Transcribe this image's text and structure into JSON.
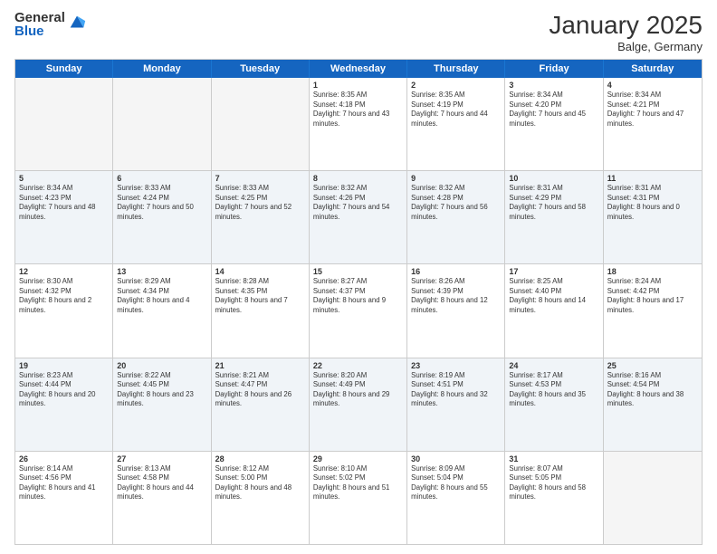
{
  "logo": {
    "general": "General",
    "blue": "Blue"
  },
  "title": "January 2025",
  "location": "Balge, Germany",
  "header_days": [
    "Sunday",
    "Monday",
    "Tuesday",
    "Wednesday",
    "Thursday",
    "Friday",
    "Saturday"
  ],
  "weeks": [
    [
      {
        "day": "",
        "sunrise": "",
        "sunset": "",
        "daylight": "",
        "empty": true
      },
      {
        "day": "",
        "sunrise": "",
        "sunset": "",
        "daylight": "",
        "empty": true
      },
      {
        "day": "",
        "sunrise": "",
        "sunset": "",
        "daylight": "",
        "empty": true
      },
      {
        "day": "1",
        "sunrise": "Sunrise: 8:35 AM",
        "sunset": "Sunset: 4:18 PM",
        "daylight": "Daylight: 7 hours and 43 minutes.",
        "empty": false
      },
      {
        "day": "2",
        "sunrise": "Sunrise: 8:35 AM",
        "sunset": "Sunset: 4:19 PM",
        "daylight": "Daylight: 7 hours and 44 minutes.",
        "empty": false
      },
      {
        "day": "3",
        "sunrise": "Sunrise: 8:34 AM",
        "sunset": "Sunset: 4:20 PM",
        "daylight": "Daylight: 7 hours and 45 minutes.",
        "empty": false
      },
      {
        "day": "4",
        "sunrise": "Sunrise: 8:34 AM",
        "sunset": "Sunset: 4:21 PM",
        "daylight": "Daylight: 7 hours and 47 minutes.",
        "empty": false
      }
    ],
    [
      {
        "day": "5",
        "sunrise": "Sunrise: 8:34 AM",
        "sunset": "Sunset: 4:23 PM",
        "daylight": "Daylight: 7 hours and 48 minutes.",
        "empty": false
      },
      {
        "day": "6",
        "sunrise": "Sunrise: 8:33 AM",
        "sunset": "Sunset: 4:24 PM",
        "daylight": "Daylight: 7 hours and 50 minutes.",
        "empty": false
      },
      {
        "day": "7",
        "sunrise": "Sunrise: 8:33 AM",
        "sunset": "Sunset: 4:25 PM",
        "daylight": "Daylight: 7 hours and 52 minutes.",
        "empty": false
      },
      {
        "day": "8",
        "sunrise": "Sunrise: 8:32 AM",
        "sunset": "Sunset: 4:26 PM",
        "daylight": "Daylight: 7 hours and 54 minutes.",
        "empty": false
      },
      {
        "day": "9",
        "sunrise": "Sunrise: 8:32 AM",
        "sunset": "Sunset: 4:28 PM",
        "daylight": "Daylight: 7 hours and 56 minutes.",
        "empty": false
      },
      {
        "day": "10",
        "sunrise": "Sunrise: 8:31 AM",
        "sunset": "Sunset: 4:29 PM",
        "daylight": "Daylight: 7 hours and 58 minutes.",
        "empty": false
      },
      {
        "day": "11",
        "sunrise": "Sunrise: 8:31 AM",
        "sunset": "Sunset: 4:31 PM",
        "daylight": "Daylight: 8 hours and 0 minutes.",
        "empty": false
      }
    ],
    [
      {
        "day": "12",
        "sunrise": "Sunrise: 8:30 AM",
        "sunset": "Sunset: 4:32 PM",
        "daylight": "Daylight: 8 hours and 2 minutes.",
        "empty": false
      },
      {
        "day": "13",
        "sunrise": "Sunrise: 8:29 AM",
        "sunset": "Sunset: 4:34 PM",
        "daylight": "Daylight: 8 hours and 4 minutes.",
        "empty": false
      },
      {
        "day": "14",
        "sunrise": "Sunrise: 8:28 AM",
        "sunset": "Sunset: 4:35 PM",
        "daylight": "Daylight: 8 hours and 7 minutes.",
        "empty": false
      },
      {
        "day": "15",
        "sunrise": "Sunrise: 8:27 AM",
        "sunset": "Sunset: 4:37 PM",
        "daylight": "Daylight: 8 hours and 9 minutes.",
        "empty": false
      },
      {
        "day": "16",
        "sunrise": "Sunrise: 8:26 AM",
        "sunset": "Sunset: 4:39 PM",
        "daylight": "Daylight: 8 hours and 12 minutes.",
        "empty": false
      },
      {
        "day": "17",
        "sunrise": "Sunrise: 8:25 AM",
        "sunset": "Sunset: 4:40 PM",
        "daylight": "Daylight: 8 hours and 14 minutes.",
        "empty": false
      },
      {
        "day": "18",
        "sunrise": "Sunrise: 8:24 AM",
        "sunset": "Sunset: 4:42 PM",
        "daylight": "Daylight: 8 hours and 17 minutes.",
        "empty": false
      }
    ],
    [
      {
        "day": "19",
        "sunrise": "Sunrise: 8:23 AM",
        "sunset": "Sunset: 4:44 PM",
        "daylight": "Daylight: 8 hours and 20 minutes.",
        "empty": false
      },
      {
        "day": "20",
        "sunrise": "Sunrise: 8:22 AM",
        "sunset": "Sunset: 4:45 PM",
        "daylight": "Daylight: 8 hours and 23 minutes.",
        "empty": false
      },
      {
        "day": "21",
        "sunrise": "Sunrise: 8:21 AM",
        "sunset": "Sunset: 4:47 PM",
        "daylight": "Daylight: 8 hours and 26 minutes.",
        "empty": false
      },
      {
        "day": "22",
        "sunrise": "Sunrise: 8:20 AM",
        "sunset": "Sunset: 4:49 PM",
        "daylight": "Daylight: 8 hours and 29 minutes.",
        "empty": false
      },
      {
        "day": "23",
        "sunrise": "Sunrise: 8:19 AM",
        "sunset": "Sunset: 4:51 PM",
        "daylight": "Daylight: 8 hours and 32 minutes.",
        "empty": false
      },
      {
        "day": "24",
        "sunrise": "Sunrise: 8:17 AM",
        "sunset": "Sunset: 4:53 PM",
        "daylight": "Daylight: 8 hours and 35 minutes.",
        "empty": false
      },
      {
        "day": "25",
        "sunrise": "Sunrise: 8:16 AM",
        "sunset": "Sunset: 4:54 PM",
        "daylight": "Daylight: 8 hours and 38 minutes.",
        "empty": false
      }
    ],
    [
      {
        "day": "26",
        "sunrise": "Sunrise: 8:14 AM",
        "sunset": "Sunset: 4:56 PM",
        "daylight": "Daylight: 8 hours and 41 minutes.",
        "empty": false
      },
      {
        "day": "27",
        "sunrise": "Sunrise: 8:13 AM",
        "sunset": "Sunset: 4:58 PM",
        "daylight": "Daylight: 8 hours and 44 minutes.",
        "empty": false
      },
      {
        "day": "28",
        "sunrise": "Sunrise: 8:12 AM",
        "sunset": "Sunset: 5:00 PM",
        "daylight": "Daylight: 8 hours and 48 minutes.",
        "empty": false
      },
      {
        "day": "29",
        "sunrise": "Sunrise: 8:10 AM",
        "sunset": "Sunset: 5:02 PM",
        "daylight": "Daylight: 8 hours and 51 minutes.",
        "empty": false
      },
      {
        "day": "30",
        "sunrise": "Sunrise: 8:09 AM",
        "sunset": "Sunset: 5:04 PM",
        "daylight": "Daylight: 8 hours and 55 minutes.",
        "empty": false
      },
      {
        "day": "31",
        "sunrise": "Sunrise: 8:07 AM",
        "sunset": "Sunset: 5:05 PM",
        "daylight": "Daylight: 8 hours and 58 minutes.",
        "empty": false
      },
      {
        "day": "",
        "sunrise": "",
        "sunset": "",
        "daylight": "",
        "empty": true
      }
    ]
  ]
}
